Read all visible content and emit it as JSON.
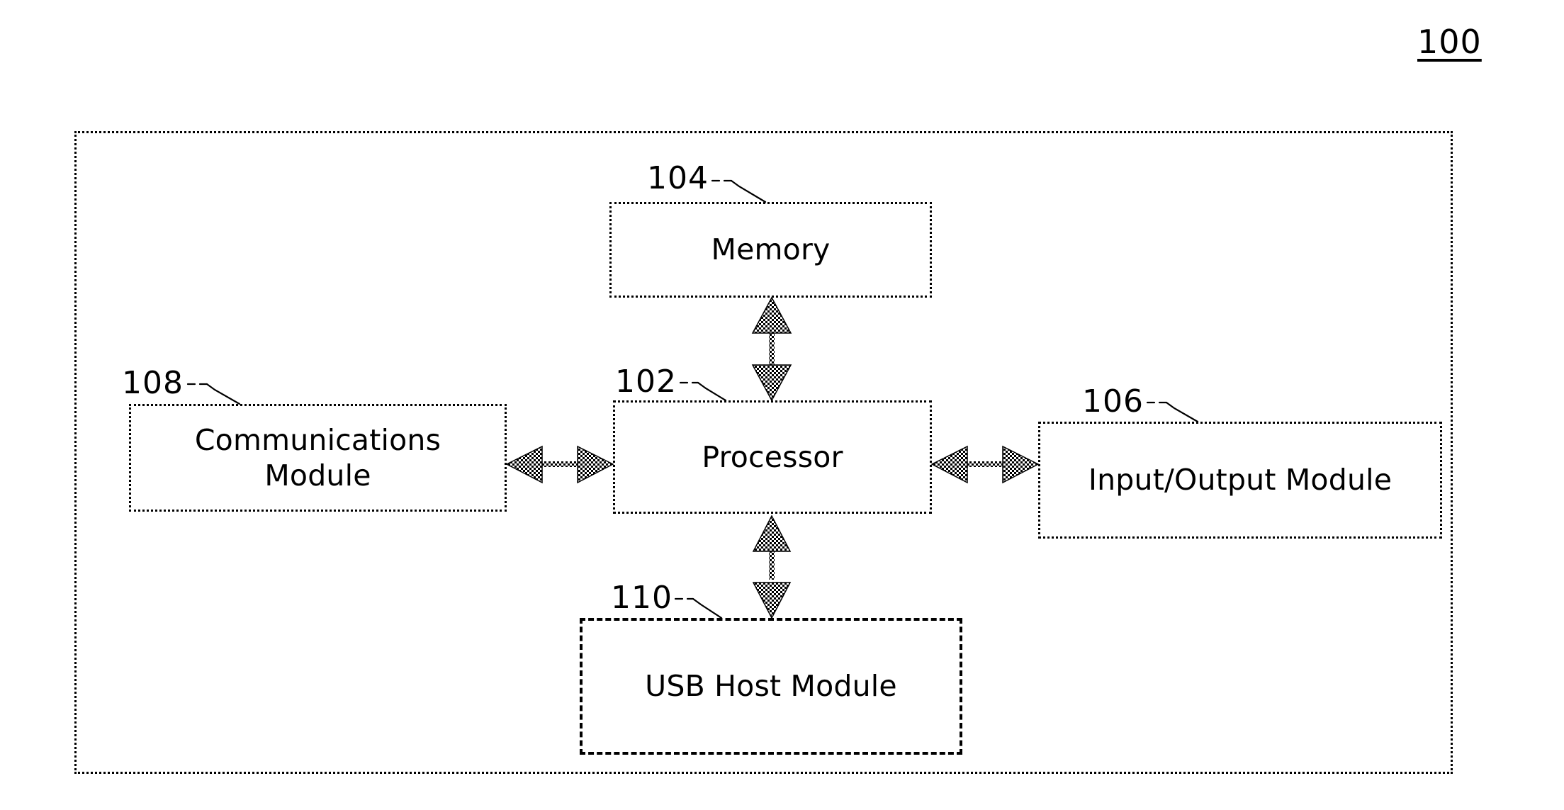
{
  "figure": {
    "number": "100",
    "type": "patent-block-diagram"
  },
  "container": {
    "name": "system-container",
    "border_style": "dotted",
    "ref": "100"
  },
  "blocks": [
    {
      "id": "processor",
      "label": "Processor",
      "ref": "102",
      "border_style": "dotted",
      "optional": false
    },
    {
      "id": "memory",
      "label": "Memory",
      "ref": "104",
      "border_style": "dotted",
      "optional": false
    },
    {
      "id": "io-module",
      "label": "Input/Output Module",
      "ref": "106",
      "border_style": "dotted",
      "optional": false
    },
    {
      "id": "communications-module",
      "label": "Communications\nModule",
      "ref": "108",
      "border_style": "dotted",
      "optional": false
    },
    {
      "id": "usb-host-module",
      "label": "USB Host Module",
      "ref": "110",
      "border_style": "dashed",
      "optional": true
    }
  ],
  "connectors": [
    {
      "id": "memory-processor",
      "from": "memory",
      "to": "processor",
      "style": "double-headed-arrow",
      "orientation": "vertical"
    },
    {
      "id": "communications-processor",
      "from": "communications-module",
      "to": "processor",
      "style": "double-headed-arrow",
      "orientation": "horizontal"
    },
    {
      "id": "processor-io",
      "from": "processor",
      "to": "io-module",
      "style": "double-headed-arrow",
      "orientation": "horizontal"
    },
    {
      "id": "processor-usb",
      "from": "processor",
      "to": "usb-host-module",
      "style": "double-headed-arrow",
      "orientation": "vertical"
    }
  ],
  "colors": {
    "ink": "#000000",
    "paper": "#ffffff"
  }
}
